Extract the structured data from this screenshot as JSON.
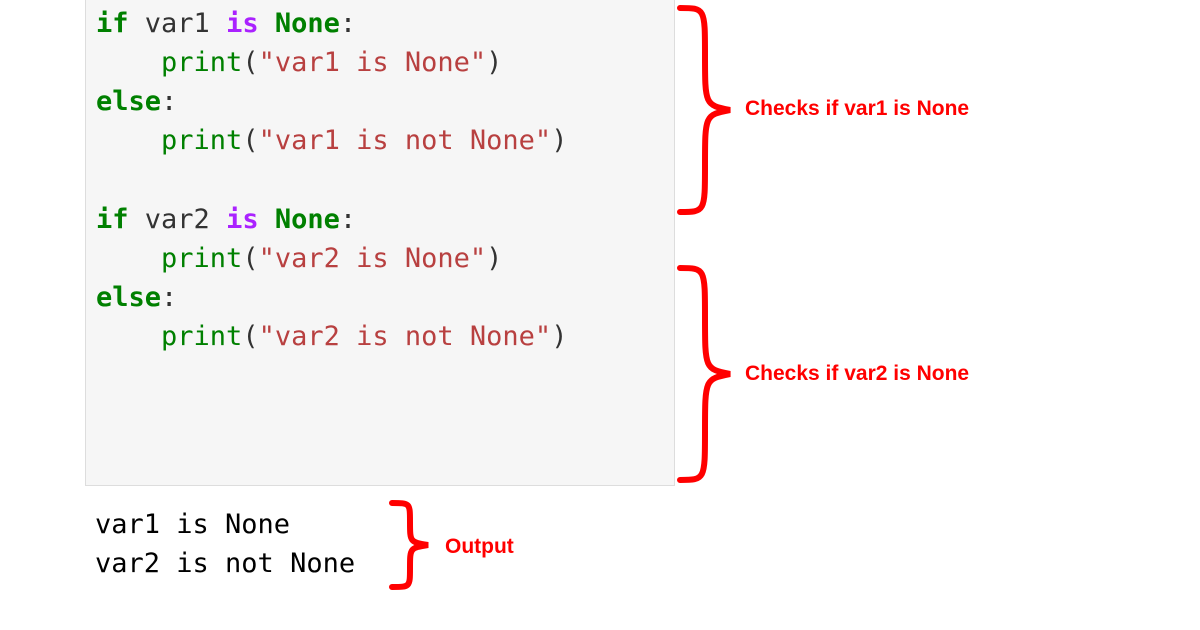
{
  "code": {
    "block1": {
      "if_kw": "if",
      "var": "var1",
      "is_kw": "is",
      "none_kw": "None",
      "colon": ":",
      "print_fn": "print",
      "str_true": "\"var1 is None\"",
      "else_kw": "else",
      "str_false": "\"var1 is not None\""
    },
    "block2": {
      "if_kw": "if",
      "var": "var2",
      "is_kw": "is",
      "none_kw": "None",
      "colon": ":",
      "print_fn": "print",
      "str_true": "\"var2 is None\"",
      "else_kw": "else",
      "str_false": "\"var2 is not None\""
    }
  },
  "output": {
    "line1": "var1 is None",
    "line2": "var2 is not None"
  },
  "annotations": {
    "block1": "Checks if var1 is None",
    "block2": "Checks if var2 is None",
    "output": "Output"
  },
  "colors": {
    "annotation": "#ff0000",
    "code_bg": "#f6f6f6",
    "keyword": "#008000",
    "operator": "#aa22ff",
    "string": "#b84040"
  }
}
